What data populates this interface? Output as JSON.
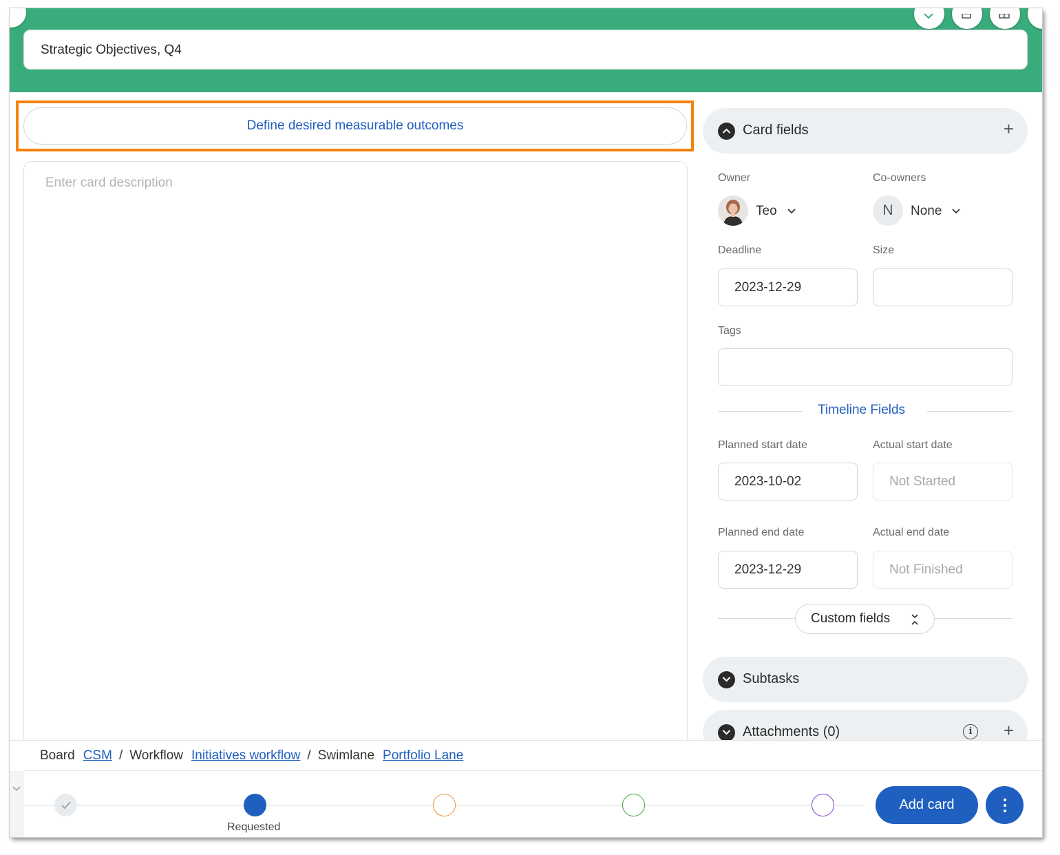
{
  "card": {
    "title": "Strategic Objectives, Q4",
    "subtitle": "Define desired measurable outcomes",
    "description_placeholder": "Enter card description"
  },
  "card_fields": {
    "section_label": "Card fields",
    "owner_label": "Owner",
    "owner_name": "Teo",
    "coowners_label": "Co-owners",
    "coowners_initial": "N",
    "coowners_value": "None",
    "deadline_label": "Deadline",
    "deadline_value": "2023-12-29",
    "size_label": "Size",
    "size_value": "",
    "tags_label": "Tags",
    "tags_value": ""
  },
  "timeline": {
    "title": "Timeline Fields",
    "planned_start_label": "Planned start date",
    "planned_start_value": "2023-10-02",
    "actual_start_label": "Actual start date",
    "actual_start_value": "Not Started",
    "planned_end_label": "Planned end date",
    "planned_end_value": "2023-12-29",
    "actual_end_label": "Actual end date",
    "actual_end_value": "Not Finished"
  },
  "custom_fields_label": "Custom fields",
  "subtasks_label": "Subtasks",
  "attachments_label": "Attachments (0)",
  "breadcrumb": {
    "board_label": "Board",
    "board_value": "CSM",
    "workflow_label": "Workflow",
    "workflow_value": "Initiatives workflow",
    "swimlane_label": "Swimlane",
    "swimlane_value": "Portfolio Lane",
    "separator": "/"
  },
  "workflow_steps": {
    "current_label": "Requested"
  },
  "actions": {
    "add_card": "Add card"
  },
  "colors": {
    "header_green": "#3aac7c",
    "accent_blue": "#1f5fbf",
    "highlight_orange": "#f5820d",
    "step_orange": "#f0922e",
    "step_green": "#3aa13a",
    "step_purple": "#7d3cc8"
  }
}
